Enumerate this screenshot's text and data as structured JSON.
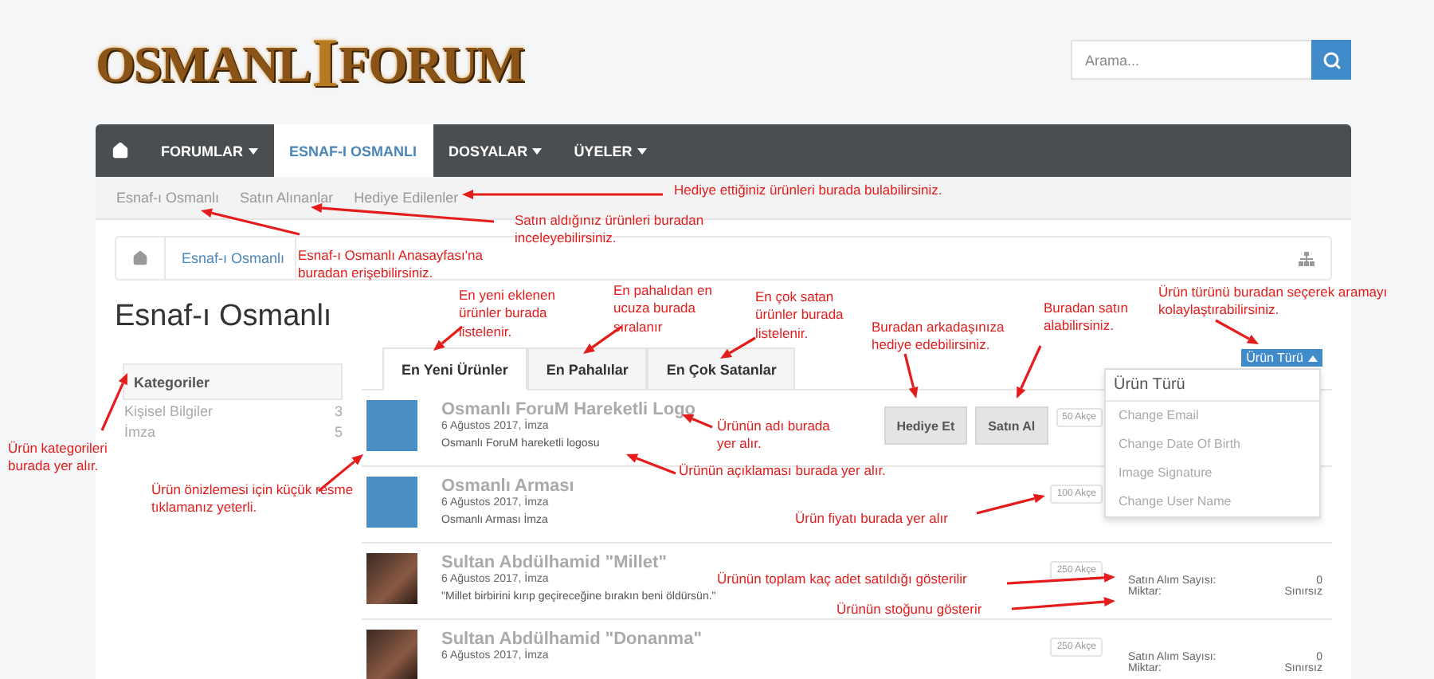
{
  "logo": {
    "parts": [
      "OSMANL",
      "I",
      "FORUM"
    ]
  },
  "search": {
    "placeholder": "Arama..."
  },
  "nav": [
    {
      "kind": "home",
      "selected": false,
      "has_menu": false
    },
    {
      "kind": "text",
      "label": "FORUMLAR",
      "selected": false,
      "has_menu": true
    },
    {
      "kind": "text",
      "label": "ESNAF-I OSMANLI",
      "selected": true,
      "has_menu": false
    },
    {
      "kind": "text",
      "label": "DOSYALAR",
      "selected": false,
      "has_menu": true
    },
    {
      "kind": "text",
      "label": "ÜYELER",
      "selected": false,
      "has_menu": true
    }
  ],
  "subnav": [
    "Esnaf-ı Osmanlı",
    "Satın Alınanlar",
    "Hediye Edilenler"
  ],
  "breadcrumb": [
    "Esnaf-ı Osmanlı"
  ],
  "title": "Esnaf-ı Osmanlı",
  "sidebar": {
    "heading": "Kategoriler",
    "items": [
      {
        "label": "Kişisel Bilgiler",
        "count": "3"
      },
      {
        "label": "İmza",
        "count": "5"
      }
    ]
  },
  "tabs": [
    {
      "label": "En Yeni Ürünler",
      "selected": true
    },
    {
      "label": "En Pahalılar",
      "selected": false
    },
    {
      "label": "En Çok Satanlar",
      "selected": false
    }
  ],
  "type_filter": {
    "label": "Ürün Türü",
    "expanded": true,
    "menu_heading": "Ürün Türü",
    "options": [
      "Change Email",
      "Change Date Of Birth",
      "Image Signature",
      "Change User Name"
    ]
  },
  "products": [
    {
      "kind": "graphic",
      "title": "Osmanlı ForuM Hareketli Logo",
      "meta": "6 Ağustos 2017, İmza",
      "description": "Osmanlı ForuM hareketli logosu",
      "buttons": [
        "Hediye Et",
        "Satın Al"
      ],
      "price": "50 Akçe"
    },
    {
      "kind": "graphic",
      "title": "Osmanlı Arması",
      "meta": "6 Ağustos 2017, İmza",
      "description": "Osmanlı Arması İmza",
      "price": "100 Akçe"
    },
    {
      "kind": "photo",
      "title": "Sultan Abdülhamid \"Millet\"",
      "meta": "6 Ağustos 2017, İmza",
      "description": "\"Millet birbirini kırıp geçireceğine bırakın beni öldürsün.\"",
      "price": "250 Akçe",
      "stats": [
        {
          "label": "Satın Alım Sayısı:",
          "value": "0"
        },
        {
          "label": "Miktar:",
          "value": "Sınırsız"
        }
      ]
    },
    {
      "kind": "photo",
      "title": "Sultan Abdülhamid \"Donanma\"",
      "meta": "6 Ağustos 2017, İmza",
      "price": "250 Akçe",
      "stats": [
        {
          "label": "Satın Alım Sayısı:",
          "value": "0"
        },
        {
          "label": "Miktar:",
          "value": "Sınırsız"
        }
      ]
    }
  ],
  "annotations": [
    "Hediye ettiğiniz ürünleri burada bulabilirsiniz.",
    "Satın aldığınız ürünleri buradan inceleyebilirsiniz.",
    "Esnaf-ı Osmanlı Anasayfası'na buradan erişebilirsiniz.",
    "En yeni eklenen ürünler burada listelenir.",
    "En pahalıdan en ucuza burada sıralanır",
    "En çok satan ürünler burada listelenir.",
    "Buradan arkadaşınıza hediye edebilirsiniz.",
    "Buradan satın alabilirsiniz.",
    "Ürün türünü buradan seçerek aramayı kolaylaştırabilirsiniz.",
    "Ürünün adı burada yer alır.",
    "Ürünün açıklaması burada yer alır.",
    "Ürün fiyatı burada yer alır",
    "Ürünün toplam kaç adet satıldığı gösterilir",
    "Ürünün stoğunu gösterir",
    "Ürün kategorileri burada yer alır.",
    "Ürün önizlemesi için küçük resme tıklamanız yeterli."
  ]
}
